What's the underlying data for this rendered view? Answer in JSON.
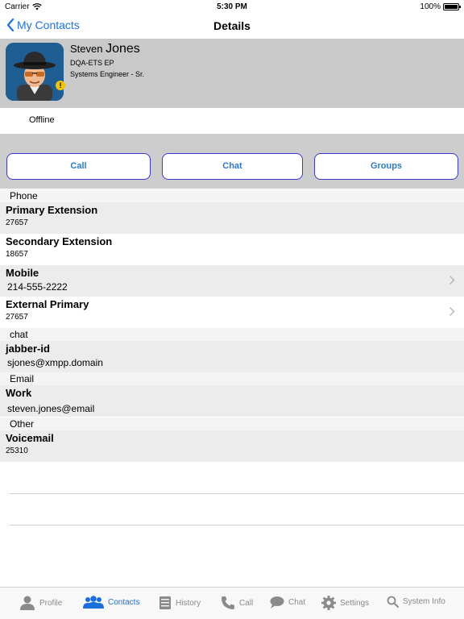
{
  "status_bar": {
    "carrier": "Carrier",
    "time": "5:30 PM",
    "battery": "100%",
    "battery_level": 1.0
  },
  "nav": {
    "back_label": "My Contacts",
    "title": "Details"
  },
  "profile": {
    "first_name": "Steven",
    "last_name": "Jones",
    "organization": "DQA-ETS EP",
    "job_title": "Systems Engineer - Sr.",
    "presence": "Offline",
    "warning_badge": "!"
  },
  "actions": {
    "call": "Call",
    "chat": "Chat",
    "groups": "Groups"
  },
  "sections": {
    "phone": {
      "header": "Phone",
      "rows": [
        {
          "label": "Primary Extension",
          "value": "27657"
        },
        {
          "label": "Secondary Extension",
          "value": "18657"
        },
        {
          "label": "Mobile",
          "value": "214-555-2222"
        },
        {
          "label": "External Primary",
          "value": "27657"
        }
      ]
    },
    "chat": {
      "header": "chat",
      "rows": [
        {
          "label": "jabber-id",
          "value": "sjones@xmpp.domain"
        }
      ]
    },
    "email": {
      "header": "Email",
      "rows": [
        {
          "label": "Work",
          "value": "steven.jones@email"
        }
      ]
    },
    "other": {
      "header": "Other",
      "rows": [
        {
          "label": "Voicemail",
          "value": "25310"
        }
      ]
    }
  },
  "tabs": [
    {
      "label": "Profile",
      "icon": "person-icon"
    },
    {
      "label": "Contacts",
      "icon": "contacts-icon"
    },
    {
      "label": "History",
      "icon": "history-icon"
    },
    {
      "label": "Call",
      "icon": "phone-icon"
    },
    {
      "label": "Chat",
      "icon": "chat-bubble-icon"
    },
    {
      "label": "Settings",
      "icon": "gear-icon"
    },
    {
      "label": "System Info",
      "icon": "search-icon"
    }
  ],
  "colors": {
    "accent": "#1a6fdb",
    "button_border": "#3a38d6",
    "header_bg": "#c9c9c9",
    "warning": "#f5c400"
  }
}
